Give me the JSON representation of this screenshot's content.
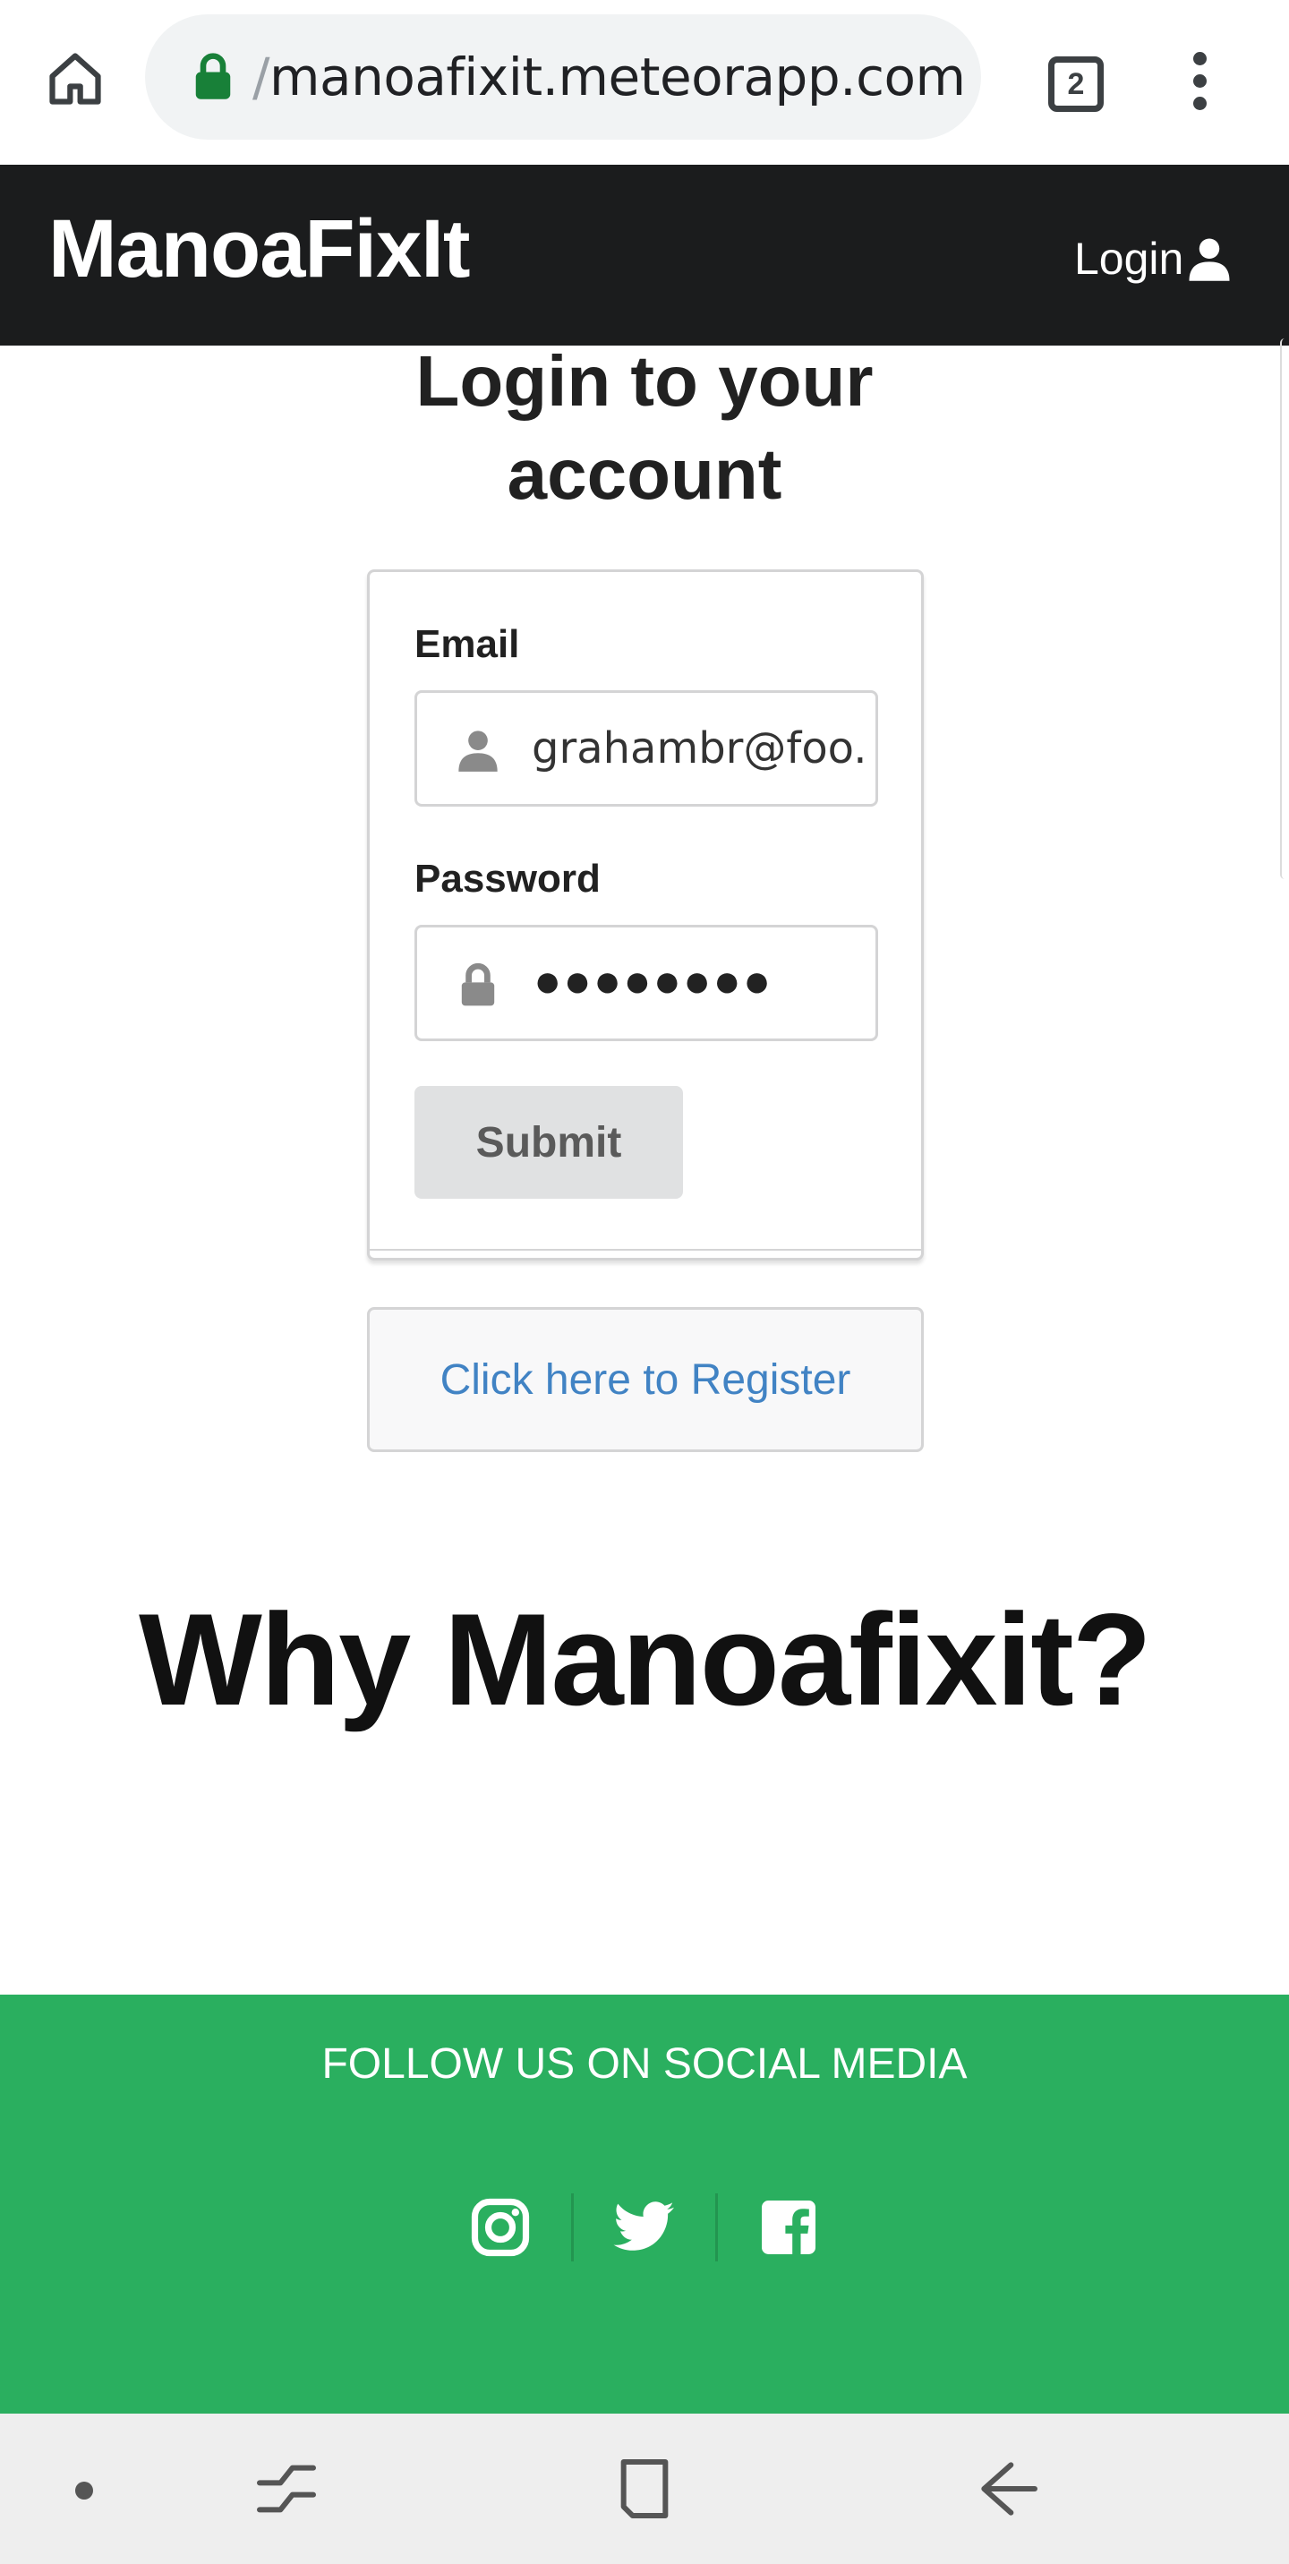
{
  "browser": {
    "url_prefix": "/",
    "url_host": "manoafixit.meteorapp.com",
    "tab_count": "2"
  },
  "navbar": {
    "brand": "ManoaFixIt",
    "login_label": "Login"
  },
  "login": {
    "heading_line1": "Login to your",
    "heading_line2": "account",
    "email_label": "Email",
    "email_value": "grahambr@foo.",
    "password_label": "Password",
    "password_mask": "●●●●●●●●",
    "submit_label": "Submit",
    "register_link": "Click here to Register"
  },
  "why": {
    "heading": "Why Manoafixit?"
  },
  "footer": {
    "follow_text": "FOLLOW US ON SOCIAL MEDIA",
    "socials": [
      "instagram-icon",
      "twitter-icon",
      "facebook-icon"
    ],
    "bg_color": "#2aaf5f"
  },
  "colors": {
    "navbar_bg": "#1b1c1d",
    "link": "#4183c4",
    "lock_green": "#188038"
  }
}
